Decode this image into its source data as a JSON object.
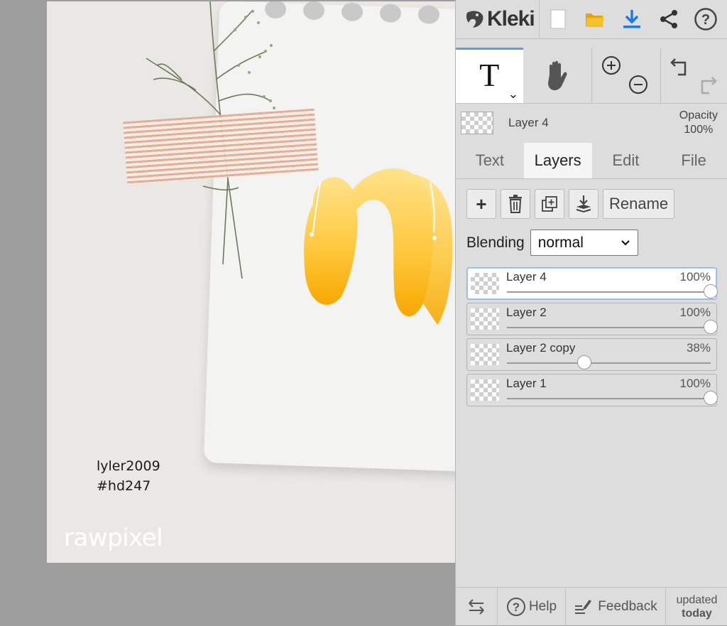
{
  "canvas": {
    "watermark_user_line1": "lyler2009",
    "watermark_user_line2": "#hd247",
    "watermark_logo": "rawpixel"
  },
  "app": {
    "name": "Kleki",
    "topbar_icons": [
      "new-image-icon",
      "open-folder-icon",
      "download-icon",
      "share-icon",
      "help-icon"
    ],
    "accent": "#5d9af0",
    "download_color": "#1e7be6",
    "folder_color": "#f2b705"
  },
  "toolbar": {
    "text_tool_glyph": "T",
    "tools": [
      "text-tool",
      "hand-tool",
      "zoom-tool",
      "undo-redo"
    ]
  },
  "current_layer": {
    "name": "Layer 4",
    "opacity_label": "Opacity",
    "opacity_value": "100%"
  },
  "tabs": [
    {
      "label": "Text",
      "active": false
    },
    {
      "label": "Layers",
      "active": true
    },
    {
      "label": "Edit",
      "active": false
    },
    {
      "label": "File",
      "active": false
    }
  ],
  "layer_actions": {
    "add_glyph": "+",
    "rename_label": "Rename"
  },
  "blending": {
    "label": "Blending",
    "value": "normal"
  },
  "layers": [
    {
      "name": "Layer 4",
      "opacity": "100%",
      "opacity_value": 1.0,
      "selected": true
    },
    {
      "name": "Layer 2",
      "opacity": "100%",
      "opacity_value": 1.0,
      "selected": false
    },
    {
      "name": "Layer 2 copy",
      "opacity": "38%",
      "opacity_value": 0.38,
      "selected": false
    },
    {
      "name": "Layer 1",
      "opacity": "100%",
      "opacity_value": 1.0,
      "selected": false
    }
  ],
  "bottombar": {
    "help_label": "Help",
    "feedback_label": "Feedback",
    "updated_line1": "updated",
    "updated_line2": "today"
  }
}
